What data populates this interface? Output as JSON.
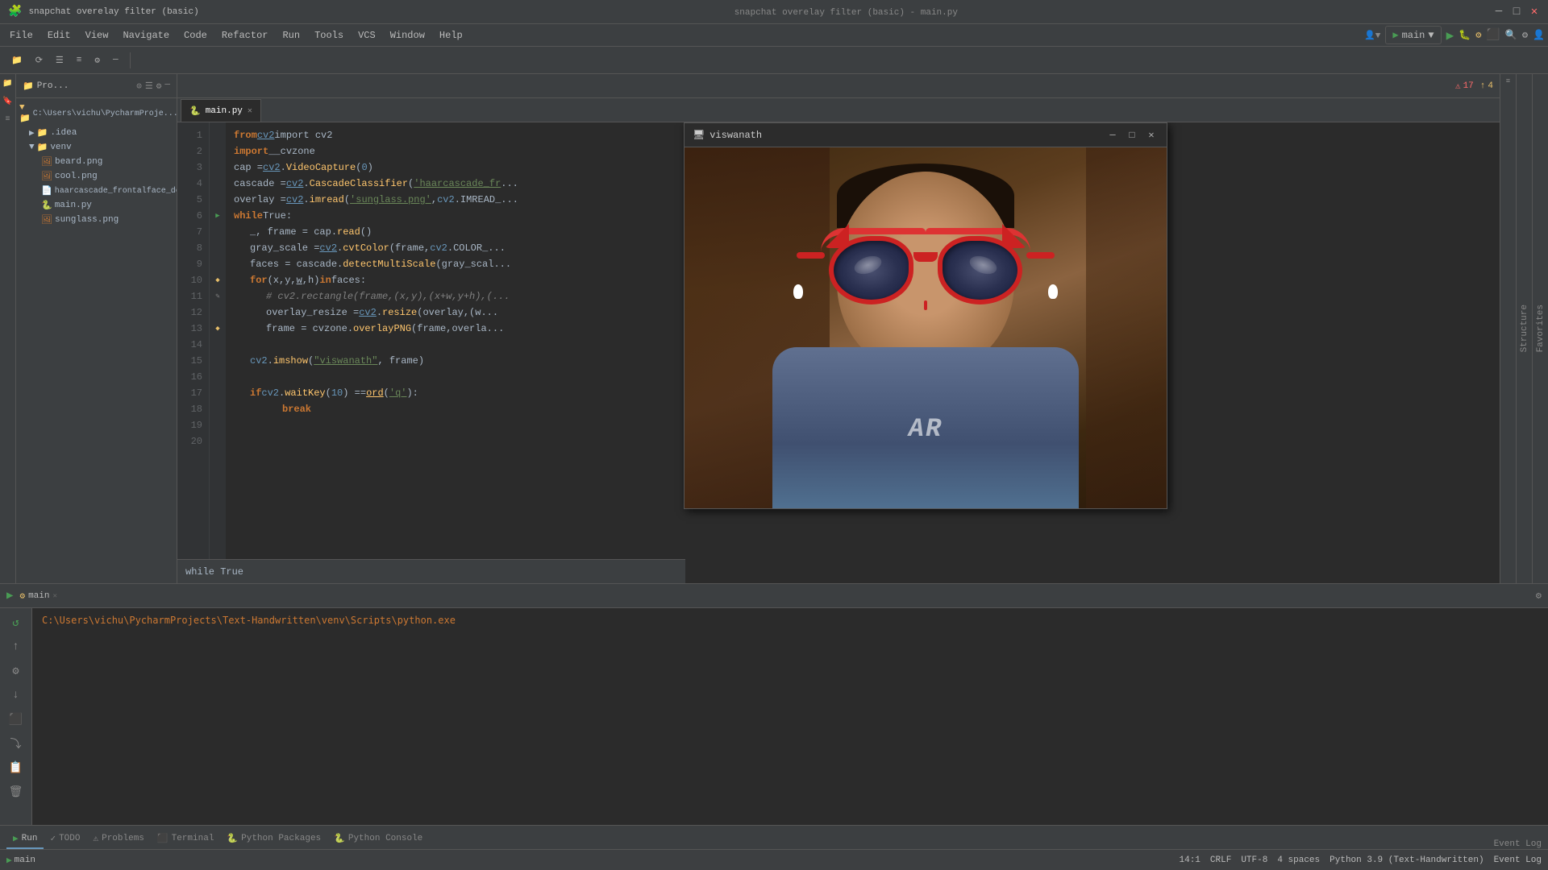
{
  "window": {
    "title": "snapchat overelay filter (basic) - main.py",
    "app_title": "snapchat overelay filter (basic)"
  },
  "title_bar": {
    "app_name": "snapchat overelay filter (basic)",
    "file_name": "main.py",
    "run_config": "main",
    "minimize": "─",
    "maximize": "□",
    "close": "✕",
    "search_icon": "🔍",
    "settings_icon": "⚙",
    "profile_icon": "👤"
  },
  "menu": {
    "items": [
      "File",
      "Edit",
      "View",
      "Navigate",
      "Code",
      "Refactor",
      "Run",
      "Tools",
      "VCS",
      "Window",
      "Help"
    ],
    "center_title": "snapchat overelay filter (basic) - main.py"
  },
  "toolbar": {
    "project_icon": "📁",
    "save_all": "💾",
    "run_label": "▶",
    "run_config_name": "main",
    "debug_icon": "🐛",
    "stop_icon": "⬛",
    "build_icon": "🔨",
    "search_label": "🔍",
    "settings_label": "⚙",
    "profile_label": "👤"
  },
  "project_panel": {
    "title": "Pro...",
    "root": "C:\\Users\\vichu\\PycharmProje...",
    "items": [
      {
        "name": ".idea",
        "type": "folder",
        "indent": 1
      },
      {
        "name": "venv",
        "type": "folder",
        "indent": 1,
        "expanded": true
      },
      {
        "name": "beard.png",
        "type": "png",
        "indent": 2
      },
      {
        "name": "cool.png",
        "type": "png",
        "indent": 2
      },
      {
        "name": "haarcascade_frontalface_de...",
        "type": "xml",
        "indent": 2
      },
      {
        "name": "main.py",
        "type": "py",
        "indent": 2
      },
      {
        "name": "sunglass.png",
        "type": "png",
        "indent": 2
      }
    ]
  },
  "editor": {
    "tab": "main.py",
    "lines": [
      {
        "num": 1,
        "code": "from cv2 import cv2"
      },
      {
        "num": 2,
        "code": "import__cvzone"
      },
      {
        "num": 3,
        "code": "cap =cv2.VideoCapture(0)"
      },
      {
        "num": 4,
        "code": "cascade = cv2.CascadeClassifier('haarcascade_fr..."
      },
      {
        "num": 5,
        "code": "overlay =cv2.imread('sunglass.png',cv2.IMREAD_..."
      },
      {
        "num": 6,
        "code": "while True:"
      },
      {
        "num": 7,
        "code": "    _, frame = cap.read()"
      },
      {
        "num": 8,
        "code": "    gray_scale = cv2.cvtColor(frame,cv2.COLOR_..."
      },
      {
        "num": 9,
        "code": "    faces = cascade.detectMultiScale(gray_scal..."
      },
      {
        "num": 10,
        "code": "    for(x,y,w,h) in faces:"
      },
      {
        "num": 11,
        "code": "        # cv2.rectangle(frame,(x,y),(x+w,y+h),..."
      },
      {
        "num": 12,
        "code": "        overlay_resize = cv2.resize(overlay,(w..."
      },
      {
        "num": 13,
        "code": "        frame = cvzone.overlayPNG(frame,overla..."
      },
      {
        "num": 14,
        "code": ""
      },
      {
        "num": 15,
        "code": "    cv2.imshow(\"viswanath\", frame)"
      },
      {
        "num": 16,
        "code": ""
      },
      {
        "num": 17,
        "code": "    if cv2.waitKey(10) ==ord('q'):"
      },
      {
        "num": 18,
        "code": "        break"
      },
      {
        "num": 19,
        "code": ""
      },
      {
        "num": 20,
        "code": ""
      }
    ],
    "after_code": "while True"
  },
  "error_bar": {
    "errors": "17",
    "warnings": "4"
  },
  "cv2_window": {
    "title": "viswanath",
    "minimize": "─",
    "maximize": "□",
    "close": "✕"
  },
  "run_panel": {
    "tab_label": "Run",
    "tab_config": "main",
    "close_icon": "✕",
    "settings_icon": "⚙",
    "terminal_path": "C:\\Users\\vichu\\PycharmProjects\\Text-Handwritten\\venv\\Scripts\\python.exe"
  },
  "bottom_tabs": [
    {
      "label": "▶ Run",
      "active": false,
      "closeable": false
    },
    {
      "label": "TODO",
      "active": false,
      "icon": "✓"
    },
    {
      "label": "⚠ Problems",
      "active": false
    },
    {
      "label": "Terminal",
      "active": false
    },
    {
      "label": "Python Packages",
      "active": false,
      "icon": "🐍"
    },
    {
      "label": "Python Console",
      "active": false,
      "icon": "🐍"
    }
  ],
  "status_bar": {
    "position": "14:1",
    "line_ending": "CRLF",
    "encoding": "UTF-8",
    "indent": "4 spaces",
    "python_version": "Python 3.9 (Text-Handwritten)",
    "event_log": "Event Log",
    "warnings_icon": "⚠",
    "errors_icon": "⛔"
  }
}
